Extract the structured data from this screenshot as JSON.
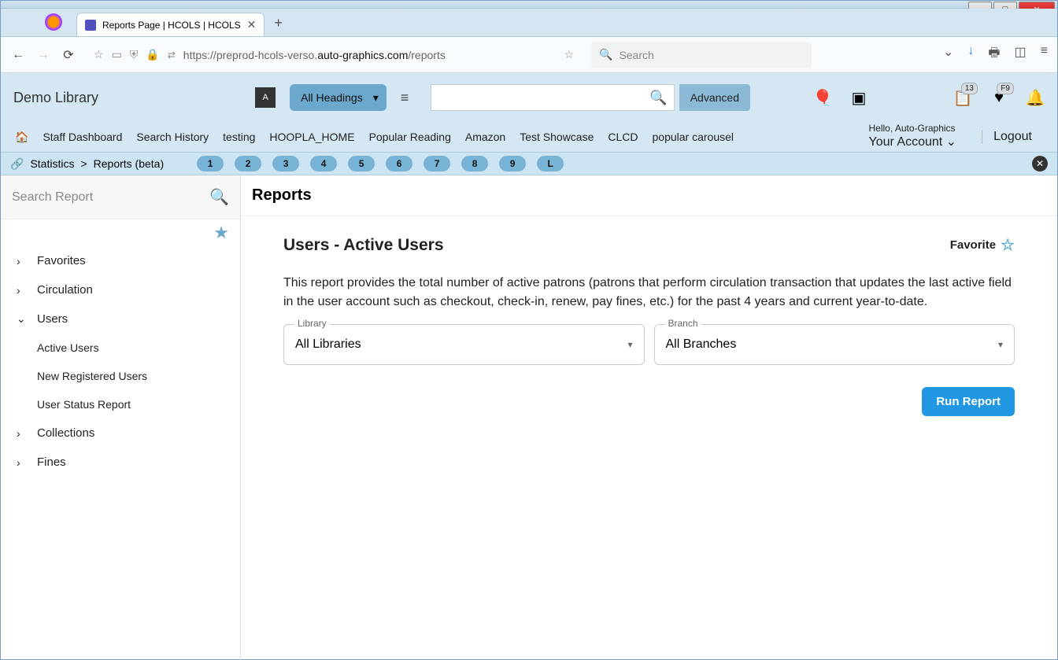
{
  "browser": {
    "tab_title": "Reports Page | HCOLS | HCOLS",
    "url": "https://preprod-hcols-verso.auto-graphics.com/reports",
    "url_domain": "auto-graphics.com",
    "search_placeholder": "Search"
  },
  "header": {
    "library_name": "Demo Library",
    "headings_label": "All Headings",
    "advanced_label": "Advanced",
    "badges": {
      "list": "13",
      "heart": "F9"
    },
    "greeting": "Hello, Auto-Graphics",
    "account_label": "Your Account",
    "logout_label": "Logout"
  },
  "nav": [
    "Staff Dashboard",
    "Search History",
    "testing",
    "HOOPLA_HOME",
    "Popular Reading",
    "Amazon",
    "Test Showcase",
    "CLCD",
    "popular carousel"
  ],
  "breadcrumb": {
    "root": "Statistics",
    "sep": ">",
    "leaf": "Reports (beta)",
    "pills": [
      "1",
      "2",
      "3",
      "4",
      "5",
      "6",
      "7",
      "8",
      "9",
      "L"
    ]
  },
  "sidebar": {
    "search_placeholder": "Search Report",
    "items": [
      {
        "label": "Favorites",
        "expanded": false
      },
      {
        "label": "Circulation",
        "expanded": false
      },
      {
        "label": "Users",
        "expanded": true,
        "children": [
          "Active Users",
          "New Registered Users",
          "User Status Report"
        ]
      },
      {
        "label": "Collections",
        "expanded": false
      },
      {
        "label": "Fines",
        "expanded": false
      }
    ]
  },
  "content": {
    "section_title": "Reports",
    "page_title": "Users - Active Users",
    "favorite_label": "Favorite",
    "description": "This report provides the total number of active patrons (patrons that perform circulation transaction that updates the last active field in the user account such as checkout, check-in, renew, pay fines, etc.) for the past 4 years and current year-to-date.",
    "library_label": "Library",
    "library_value": "All Libraries",
    "branch_label": "Branch",
    "branch_value": "All Branches",
    "run_label": "Run Report"
  }
}
